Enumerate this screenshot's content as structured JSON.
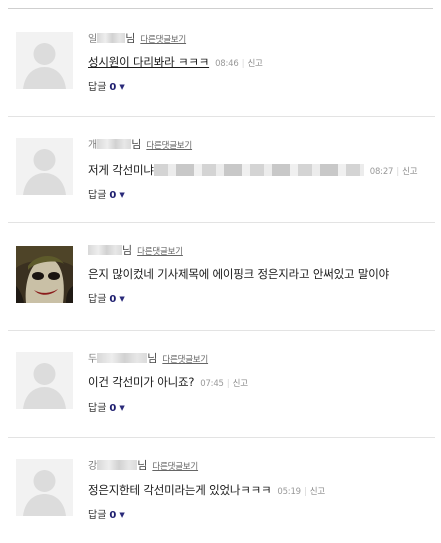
{
  "comments": [
    {
      "name_head": "일",
      "name_tail": "님",
      "view_replies": "다른댓글보기",
      "text": "성시원이 다리봐라 ㅋㅋㅋ",
      "time": "08:46",
      "report": "신고",
      "reply_label": "답글",
      "reply_count": "0",
      "avatar": "default"
    },
    {
      "name_head": "개",
      "name_tail": "님",
      "view_replies": "다른댓글보기",
      "text": "저게 각선미냐",
      "time": "08:27",
      "report": "신고",
      "reply_label": "답글",
      "reply_count": "0",
      "avatar": "default"
    },
    {
      "name_head": "",
      "name_tail": "님",
      "view_replies": "다른댓글보기",
      "text": "은지 많이컸네 기사제목에 에이핑크 정은지라고 안써있고 말이야",
      "time": "",
      "report": "",
      "reply_label": "답글",
      "reply_count": "0",
      "avatar": "joker"
    },
    {
      "name_head": "두",
      "name_tail": "님",
      "view_replies": "다른댓글보기",
      "text": "이건 각선미가 아니죠?",
      "time": "07:45",
      "report": "신고",
      "reply_label": "답글",
      "reply_count": "0",
      "avatar": "default"
    },
    {
      "name_head": "강",
      "name_tail": "님",
      "view_replies": "다른댓글보기",
      "text": "정은지한테 각선미라는게 있었나ㅋㅋㅋ",
      "time": "05:19",
      "report": "신고",
      "reply_label": "답글",
      "reply_count": "0",
      "avatar": "default"
    }
  ]
}
